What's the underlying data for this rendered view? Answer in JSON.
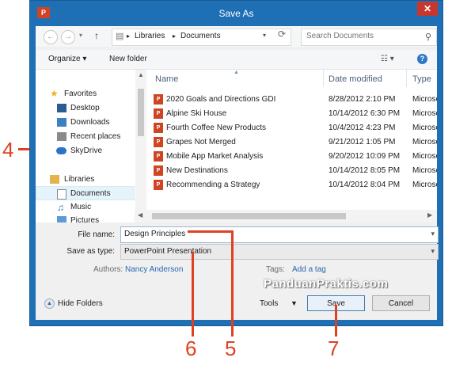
{
  "window": {
    "title": "Save As",
    "app_icon": "powerpoint-icon",
    "close_glyph": "✕"
  },
  "nav_bar": {
    "back_glyph": "←",
    "forward_glyph": "→",
    "up_glyph": "↑",
    "address_parts": [
      "Libraries",
      "Documents"
    ],
    "separator": "▸",
    "refresh_glyph": "⟳",
    "search_placeholder": "Search Documents"
  },
  "toolbar": {
    "organize_label": "Organize ▾",
    "new_folder_label": "New folder",
    "view_glyph": "☷ ▾",
    "help_glyph": "?"
  },
  "nav_pane": {
    "items": [
      {
        "label": "Favorites",
        "icon": "star-icon",
        "header": true
      },
      {
        "label": "Desktop",
        "icon": "desktop-icon"
      },
      {
        "label": "Downloads",
        "icon": "downloads-icon"
      },
      {
        "label": "Recent places",
        "icon": "recent-places-icon"
      },
      {
        "label": "SkyDrive",
        "icon": "cloud-icon"
      },
      {
        "label": "Libraries",
        "icon": "libraries-icon",
        "header": true
      },
      {
        "label": "Documents",
        "icon": "documents-icon",
        "selected": true
      },
      {
        "label": "Music",
        "icon": "music-icon"
      },
      {
        "label": "Pictures",
        "icon": "pictures-icon"
      }
    ]
  },
  "file_list": {
    "columns": [
      "Name",
      "Date modified",
      "Type"
    ],
    "rows": [
      {
        "name": "2020 Goals and Directions GDI",
        "date": "8/28/2012 2:10 PM",
        "type": "Microsoft"
      },
      {
        "name": "Alpine Ski House",
        "date": "10/14/2012 6:30 PM",
        "type": "Microsoft"
      },
      {
        "name": "Fourth Coffee New Products",
        "date": "10/4/2012 4:23 PM",
        "type": "Microsoft"
      },
      {
        "name": "Grapes Not Merged",
        "date": "9/21/2012 1:05 PM",
        "type": "Microsoft"
      },
      {
        "name": "Mobile App Market Analysis",
        "date": "9/20/2012 10:09 PM",
        "type": "Microsoft"
      },
      {
        "name": "New Destinations",
        "date": "10/14/2012 8:05 PM",
        "type": "Microsoft"
      },
      {
        "name": "Recommending a Strategy",
        "date": "10/14/2012 8:04 PM",
        "type": "Microsoft"
      }
    ]
  },
  "form": {
    "file_name_label": "File name:",
    "file_name_value": "Design Principles",
    "save_as_type_label": "Save as type:",
    "save_as_type_value": "PowerPoint Presentation",
    "authors_label": "Authors:",
    "authors_value": "Nancy Anderson",
    "tags_label": "Tags:",
    "tags_value": "Add a tag"
  },
  "footer": {
    "hide_folders_label": "Hide Folders",
    "tools_label": "Tools",
    "save_label": "Save",
    "cancel_label": "Cancel"
  },
  "watermark": "PanduanPraktis.com",
  "callouts": [
    "4",
    "5",
    "6",
    "7"
  ],
  "colors": {
    "title_bar": "#1f6fb5",
    "callout": "#e0401f",
    "link": "#2a66b4",
    "powerpoint": "#d04423"
  }
}
